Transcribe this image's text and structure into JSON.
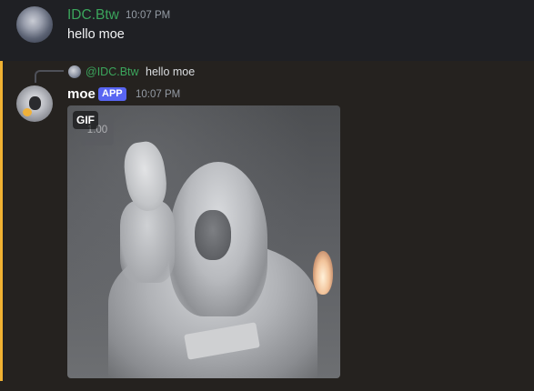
{
  "messages": [
    {
      "author": "IDC.Btw",
      "timestamp": "10:07 PM",
      "content": "hello moe",
      "author_color": "#3ba55c"
    },
    {
      "author": "moe",
      "badge": "APP",
      "timestamp": "10:07 PM",
      "reply": {
        "mention": "@IDC.Btw",
        "text": "hello moe"
      },
      "attachment": {
        "type_label": "GIF",
        "overlay_text": "1.00"
      },
      "mention_bar_color": "#f0b232"
    }
  ],
  "colors": {
    "background": "#1e1f22",
    "mention_highlight": "#25221f",
    "badge": "#5865f2",
    "timestamp": "#949ba4"
  }
}
